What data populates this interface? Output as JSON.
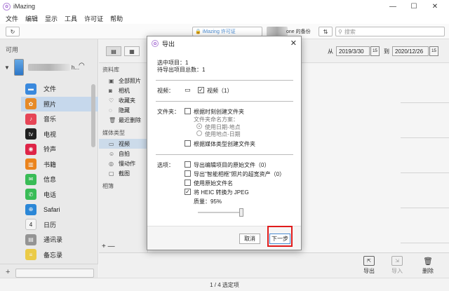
{
  "app": {
    "title": "iMazing"
  },
  "menu": [
    "文件",
    "编辑",
    "显示",
    "工具",
    "许可证",
    "帮助"
  ],
  "window_controls": {
    "minimize": "—",
    "maximize": "☐",
    "close": "✕"
  },
  "toolbar": {
    "refresh": "↻",
    "license_label": "iMazing 许可证",
    "backup_label": "one 的备份",
    "transfer": "⇅",
    "search_placeholder": "搜索"
  },
  "sidebar": {
    "header": "可用",
    "device_suffix": "h...",
    "items": [
      {
        "label": "文件",
        "icon": "folder-icon",
        "color": "#3d8fe6",
        "glyph": "▬"
      },
      {
        "label": "照片",
        "icon": "photos-icon",
        "color": "#f0902a",
        "glyph": "✿"
      },
      {
        "label": "音乐",
        "icon": "music-icon",
        "color": "#f0485a",
        "glyph": "♪"
      },
      {
        "label": "电视",
        "icon": "tv-icon",
        "color": "#222222",
        "glyph": "tv"
      },
      {
        "label": "铃声",
        "icon": "ringtone-icon",
        "color": "#e8264a",
        "glyph": "◉"
      },
      {
        "label": "书籍",
        "icon": "books-icon",
        "color": "#f58a1f",
        "glyph": "▥"
      },
      {
        "label": "信息",
        "icon": "messages-icon",
        "color": "#3cc45a",
        "glyph": "✉"
      },
      {
        "label": "电话",
        "icon": "phone-icon",
        "color": "#3cc45a",
        "glyph": "✆"
      },
      {
        "label": "Safari",
        "icon": "safari-icon",
        "color": "#2d8de0",
        "glyph": "⊕"
      },
      {
        "label": "日历",
        "icon": "calendar-icon",
        "color": "#ffffff",
        "glyph": "4"
      },
      {
        "label": "通讯录",
        "icon": "contacts-icon",
        "color": "#9b9b9b",
        "glyph": "▤"
      },
      {
        "label": "备忘录",
        "icon": "notes-icon",
        "color": "#f5d44a",
        "glyph": "≡"
      }
    ],
    "add": "+"
  },
  "subtoolbar": {
    "from_label": "从",
    "from_date": "2019/3/30",
    "to_label": "到",
    "to_date": "2020/12/26",
    "cal_day": "15"
  },
  "library": {
    "header1": "资料库",
    "items1": [
      {
        "label": "全部照片",
        "glyph": "▣"
      },
      {
        "label": "相机",
        "glyph": "◙"
      },
      {
        "label": "收藏夹",
        "glyph": "♡"
      },
      {
        "label": "隐藏",
        "glyph": "◌"
      },
      {
        "label": "最近删除",
        "glyph": "🗑"
      }
    ],
    "header2": "媒体类型",
    "items2": [
      {
        "label": "视频",
        "glyph": "▭"
      },
      {
        "label": "自拍",
        "glyph": "☺"
      },
      {
        "label": "慢动作",
        "glyph": "◎"
      },
      {
        "label": "截图",
        "glyph": "▢"
      }
    ],
    "header3": "相簿",
    "add_remove": "+ —"
  },
  "bottom": {
    "export": "导出",
    "import": "导入",
    "delete": "删除"
  },
  "status": "1 / 4 选定项",
  "dialog": {
    "title": "导出",
    "selected": "选中项目：1",
    "total": "待导出项目总数：1",
    "video_label": "视频：",
    "video_option": "视频（1）",
    "folder_label": "文件夹：",
    "create_by_time": "根据时刻创建文件夹",
    "naming_scheme": "文件夹命名方案：",
    "use_date_place": "使用日期-地点",
    "use_place_date": "使用地点-日期",
    "create_by_media": "根据媒体类型创建文件夹",
    "options_label": "选项：",
    "export_original": "导出编辑项目的原始文件（0）",
    "export_smart": "导出\"智能相框\"照片的超宽资产（0）",
    "use_original_name": "使用原始文件名",
    "heic_convert": "将 HEIC 转换为 JPEG",
    "quality": "质量：95%",
    "quality_value": 95,
    "cancel": "取消",
    "next": "下一步"
  }
}
